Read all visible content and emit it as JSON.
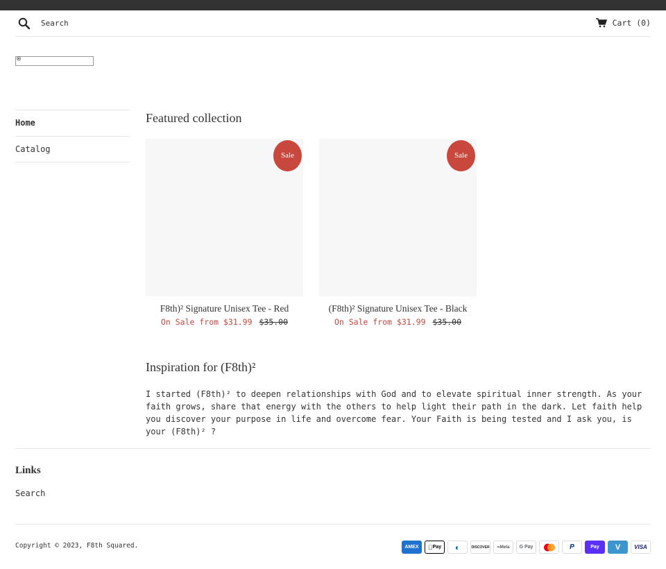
{
  "header": {
    "search_placeholder": "Search",
    "cart_label": "Cart (0)"
  },
  "logo": {
    "glyph": "®"
  },
  "sidebar": {
    "items": [
      {
        "label": "Home"
      },
      {
        "label": "Catalog"
      }
    ]
  },
  "featured": {
    "title": "Featured collection",
    "products": [
      {
        "title": "F8th)² Signature Unisex Tee - Red",
        "badge": "Sale",
        "sale_price": "On Sale from $31.99",
        "compare_price": "$35.00"
      },
      {
        "title": "(F8th)² Signature Unisex Tee - Black",
        "badge": "Sale",
        "sale_price": "On Sale from $31.99",
        "compare_price": "$35.00"
      }
    ]
  },
  "inspiration": {
    "title": "Inspiration for (F8th)²",
    "body": "I started (F8th)² to deepen relationships with God and to elevate spiritual inner strength. As your faith grows, share that energy with the others to help light their path in the dark. Let faith help you discover your purpose in life and overcome fear. Your Faith is being tested and I ask you, is your (F8th)² ?"
  },
  "footer": {
    "links_title": "Links",
    "links": [
      {
        "label": "Search"
      }
    ],
    "copyright": "Copyright © 2023, F8th Squared."
  },
  "payments": [
    {
      "name": "american-express",
      "label": "AMEX",
      "bg": "#1f72cd",
      "fg": "#ffffff"
    },
    {
      "name": "apple-pay",
      "label": "Pay",
      "bg": "#ffffff",
      "fg": "#000000"
    },
    {
      "name": "diners-club",
      "label": "◐",
      "bg": "#ffffff",
      "fg": "#0165ac"
    },
    {
      "name": "discover",
      "label": "DISCOVER",
      "bg": "#ffffff",
      "fg": "#222222"
    },
    {
      "name": "meta-pay",
      "label": "∞Meta",
      "bg": "#ffffff",
      "fg": "#555555"
    },
    {
      "name": "google-pay",
      "label": "G Pay",
      "bg": "#ffffff",
      "fg": "#5f6368"
    },
    {
      "name": "mastercard",
      "label": "",
      "bg": "#ffffff",
      "fg": "#eb001b"
    },
    {
      "name": "paypal",
      "label": "P",
      "bg": "#ffffff",
      "fg": "#003087"
    },
    {
      "name": "shop-pay",
      "label": "Pay",
      "bg": "#5a31f4",
      "fg": "#ffffff"
    },
    {
      "name": "venmo",
      "label": "V",
      "bg": "#3d95ce",
      "fg": "#ffffff"
    },
    {
      "name": "visa",
      "label": "VISA",
      "bg": "#ffffff",
      "fg": "#1a1f71"
    }
  ]
}
